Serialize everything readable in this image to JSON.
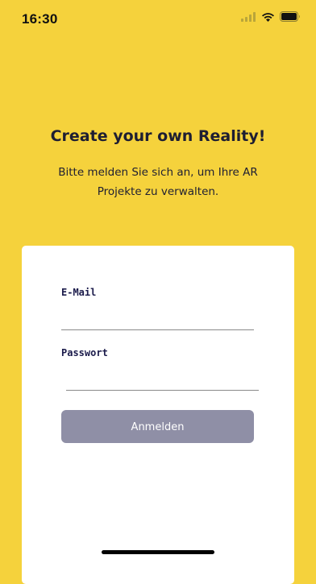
{
  "status_bar": {
    "time": "16:30",
    "icons": [
      "cellular-signal-icon",
      "wifi-icon",
      "battery-icon"
    ]
  },
  "header": {
    "title": "Create your own Reality!",
    "subtitle": "Bitte melden Sie sich an, um Ihre AR Projekte zu verwalten."
  },
  "login_form": {
    "email_label": "E-Mail",
    "email_value": "",
    "password_label": "Passwort",
    "password_value": "",
    "submit_label": "Anmelden"
  },
  "colors": {
    "background": "#F5D23C",
    "card": "#FFFFFF",
    "button": "#8F8FA6",
    "text_dark": "#1E1E32"
  }
}
